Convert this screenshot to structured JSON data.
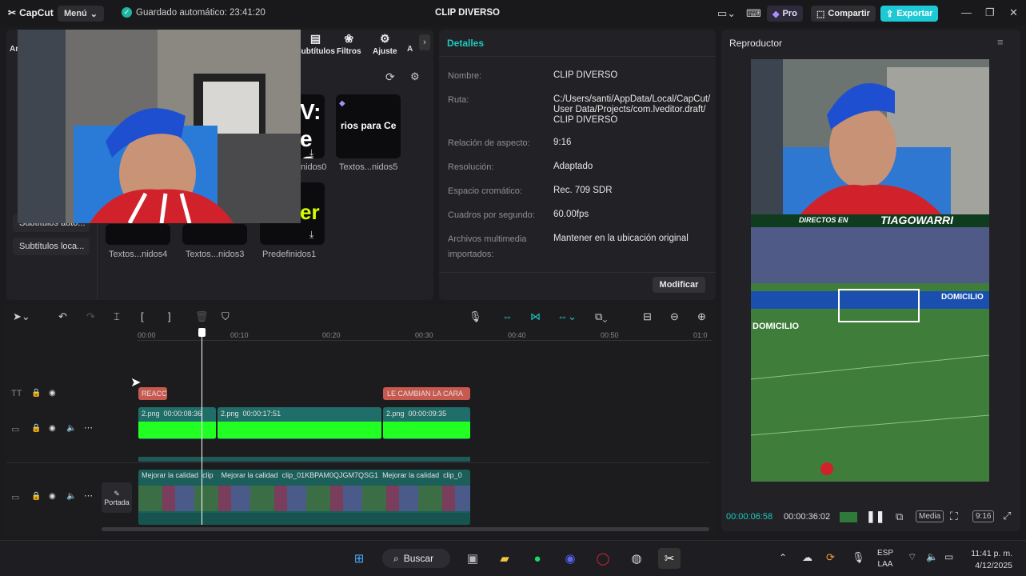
{
  "titlebar": {
    "logo": "CapCut",
    "menu": "Menú",
    "autosave": "Guardado automático: 23:41:20",
    "project_title": "CLIP DIVERSO",
    "pro": "Pro",
    "share": "Compartir",
    "export": "Exportar"
  },
  "media": {
    "nav": [
      "Subtítulos",
      "Filtros",
      "Ajuste"
    ],
    "side_items": [
      "Subtítulos auto...",
      "Subtítulos loca..."
    ],
    "thumbs": [
      "Textos...nidos0",
      "Textos...nidos5",
      "Textos...nidos4",
      "Textos...nidos3",
      "Predefinidos1"
    ],
    "thumb_texts": [
      "V:",
      "e C",
      "rios para Ce",
      "er"
    ]
  },
  "details": {
    "header": "Detalles",
    "rows": [
      {
        "label": "Nombre:",
        "value": "CLIP DIVERSO"
      },
      {
        "label": "Ruta:",
        "value_lines": [
          "C:/Users/santi/AppData/Local/CapCut/",
          "User Data/Projects/com.lveditor.draft/",
          "CLIP DIVERSO"
        ]
      },
      {
        "label": "Relación de aspecto:",
        "value": "9:16"
      },
      {
        "label": "Resolución:",
        "value": "Adaptado"
      },
      {
        "label": "Espacio cromático:",
        "value": "Rec. 709 SDR"
      },
      {
        "label": "Cuadros por segundo:",
        "value": "60.00fps"
      },
      {
        "label_lines": [
          "Archivos multimedia",
          "importados:"
        ],
        "value": "Mantener en la ubicación original"
      }
    ],
    "modify": "Modificar"
  },
  "player": {
    "header": "Reproductor",
    "banner": "DIRECTOS EN",
    "banner_name": "TIAGOWARRI",
    "ad_left": "DOMICILIO",
    "ad_right": "DOMICILIO",
    "current_time": "00:00:06:58",
    "total_time": "00:00:36:02",
    "media_btn": "Media",
    "ratio_btn": "9:16"
  },
  "timeline": {
    "ticks": [
      "00:00",
      "00:10",
      "00:20",
      "00:30",
      "00:40",
      "00:50",
      "01:0"
    ],
    "text_clips": [
      "REACC",
      "LE CAMBIAN LA CARA"
    ],
    "overlay_clips": [
      {
        "name": "2.png",
        "time": "00:00:08:36"
      },
      {
        "name": "2.png",
        "time": "00:00:17:51"
      },
      {
        "name": "2.png",
        "time": "00:00:09:35"
      }
    ],
    "main_clip_labels": [
      "Mejorar la calidad",
      "clip",
      "Mejorar la calidad",
      "clip_01KBPAM0QJGM7QSG1",
      "Mejorar la calidad",
      "clip_0"
    ],
    "cover": "Portada"
  },
  "taskbar": {
    "search": "Buscar",
    "lang": "ESP",
    "lang2": "LAA",
    "time": "11:41 p. m.",
    "date": "4/12/2025"
  },
  "colors": {
    "accent": "#1fb5a3",
    "export": "#1ec9d6",
    "green_clip": "#22ff22",
    "text_clip": "#c8594f"
  }
}
